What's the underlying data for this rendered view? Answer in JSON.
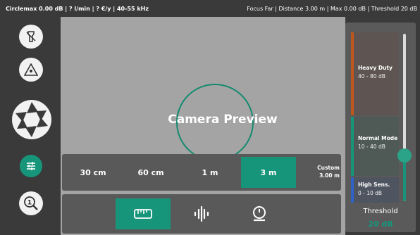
{
  "status": {
    "left": "Circlemax 0.00 dB | ? l/min | ? €/y | 40-55 kHz",
    "right": "Focus Far | Distance 3.00 m | Max 0.00 dB | Threshold 20 dB"
  },
  "sidebar": {
    "items": [
      {
        "icon": "flashlight-off-icon"
      },
      {
        "icon": "laser-warning-icon"
      },
      {
        "icon": "aperture-icon"
      },
      {
        "icon": "sliders-icon",
        "active": true
      },
      {
        "icon": "search-one-icon"
      }
    ]
  },
  "preview": {
    "title": "Camera Preview"
  },
  "distance": {
    "options": [
      "30 cm",
      "60 cm",
      "1 m",
      "3 m"
    ],
    "selected": "3 m",
    "custom_label": "Custom",
    "custom_value": "3.00 m"
  },
  "tools": {
    "items": [
      "ruler-icon",
      "waveform-icon",
      "gauge-icon"
    ],
    "active": "ruler-icon"
  },
  "threshold": {
    "segments": [
      {
        "name": "Heavy Duty",
        "range": "40 - 80 dB",
        "color": "#c0561c"
      },
      {
        "name": "Normal Mode",
        "range": "10 - 40 dB",
        "color": "#17957a"
      },
      {
        "name": "High Sens.",
        "range": "0 - 10 dB",
        "color": "#2f63c7"
      }
    ],
    "label": "Threshold",
    "value": "20 dB",
    "level_db": 20,
    "max_db": 80
  },
  "colors": {
    "accent": "#17957a",
    "panel": "#595959",
    "preview": "#a4a4a4"
  }
}
